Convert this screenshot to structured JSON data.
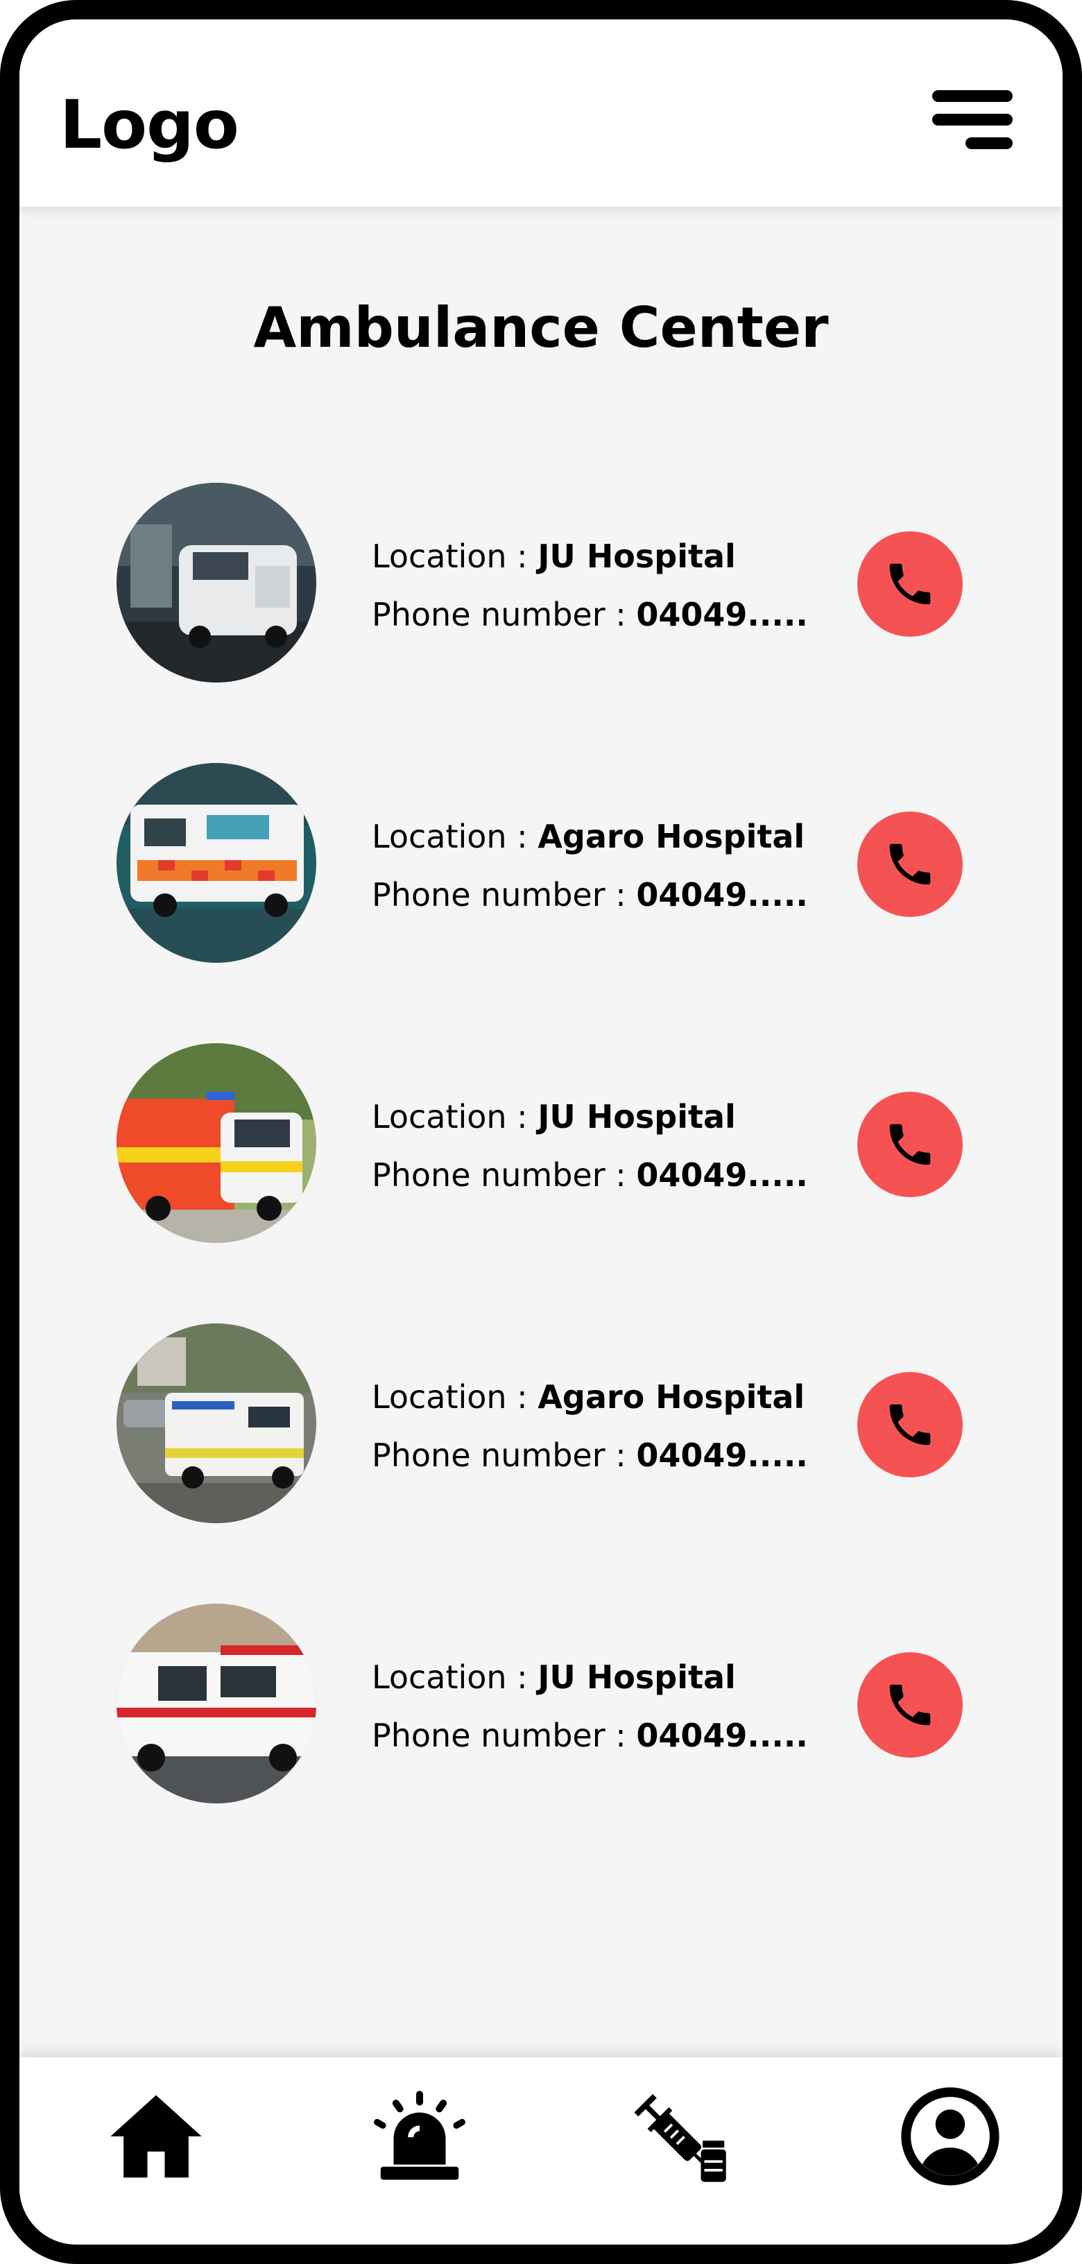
{
  "header": {
    "logo": "Logo"
  },
  "page": {
    "title": "Ambulance Center"
  },
  "labels": {
    "location": "Location : ",
    "phone": "Phone number : "
  },
  "contacts": [
    {
      "location": "JU Hospital",
      "phone": "04049....."
    },
    {
      "location": "Agaro Hospital",
      "phone": "04049....."
    },
    {
      "location": "JU Hospital",
      "phone": "04049....."
    },
    {
      "location": "Agaro Hospital",
      "phone": "04049....."
    },
    {
      "location": "JU Hospital",
      "phone": "04049....."
    }
  ],
  "colors": {
    "call_button": "#f55353",
    "background": "#f5f5f5",
    "frame": "#000000"
  },
  "icons": {
    "menu": "hamburger-menu-icon",
    "call": "phone-icon",
    "nav": [
      "home-icon",
      "siren-icon",
      "syringe-vial-icon",
      "user-icon"
    ]
  }
}
